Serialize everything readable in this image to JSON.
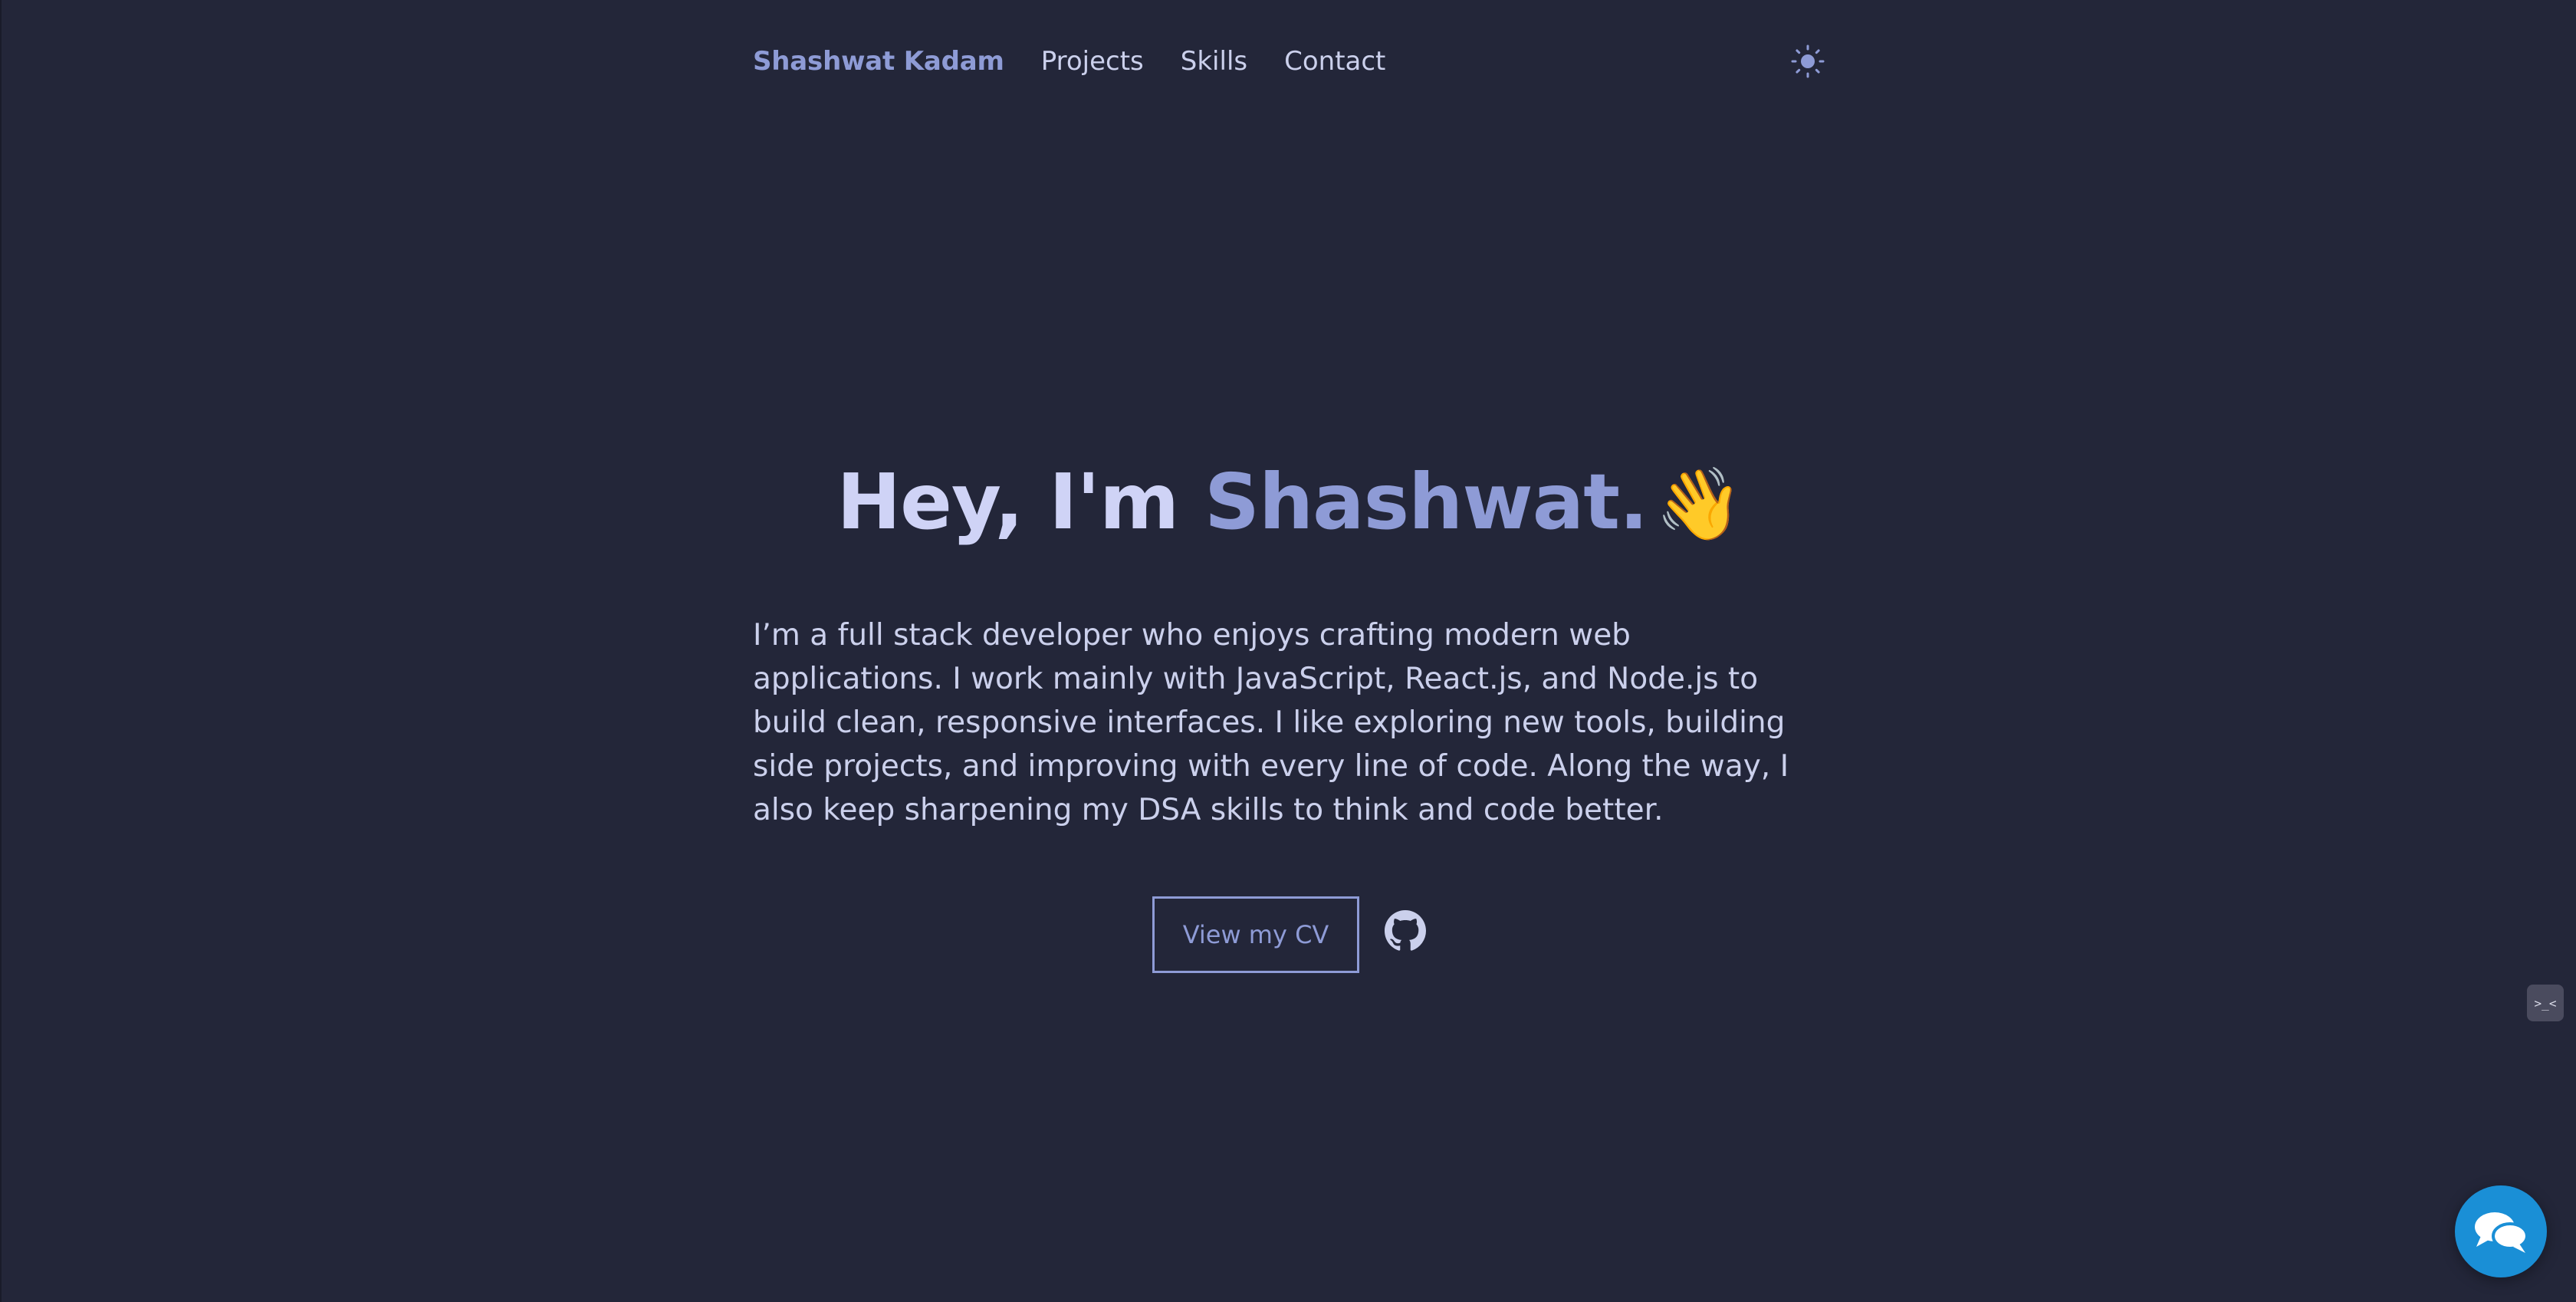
{
  "nav": {
    "brand": "Shashwat Kadam",
    "links": [
      "Projects",
      "Skills",
      "Contact"
    ],
    "theme_toggle_icon": "sun-icon"
  },
  "hero": {
    "greeting": "Hey, I'm ",
    "name": "Shashwat.",
    "emoji": "👋",
    "bio": "I’m a full stack developer who enjoys crafting modern web applications. I work mainly with JavaScript, React.js, and Node.js to build clean, responsive interfaces. I like exploring new tools, building side projects, and improving with every line of code. Along the way, I also keep sharpening my DSA skills to think and code better.",
    "cv_button": "View my CV",
    "github_icon": "github-icon"
  },
  "widgets": {
    "side_widget_icon": "terminal-face-icon",
    "side_widget_text": ">_<",
    "chat_icon": "chat-bubbles-icon"
  },
  "colors": {
    "background": "#232639",
    "accent": "#8e9bd6",
    "heading": "#cfd3f6",
    "text": "#cbd0ec",
    "chat": "#1a8fd6"
  }
}
